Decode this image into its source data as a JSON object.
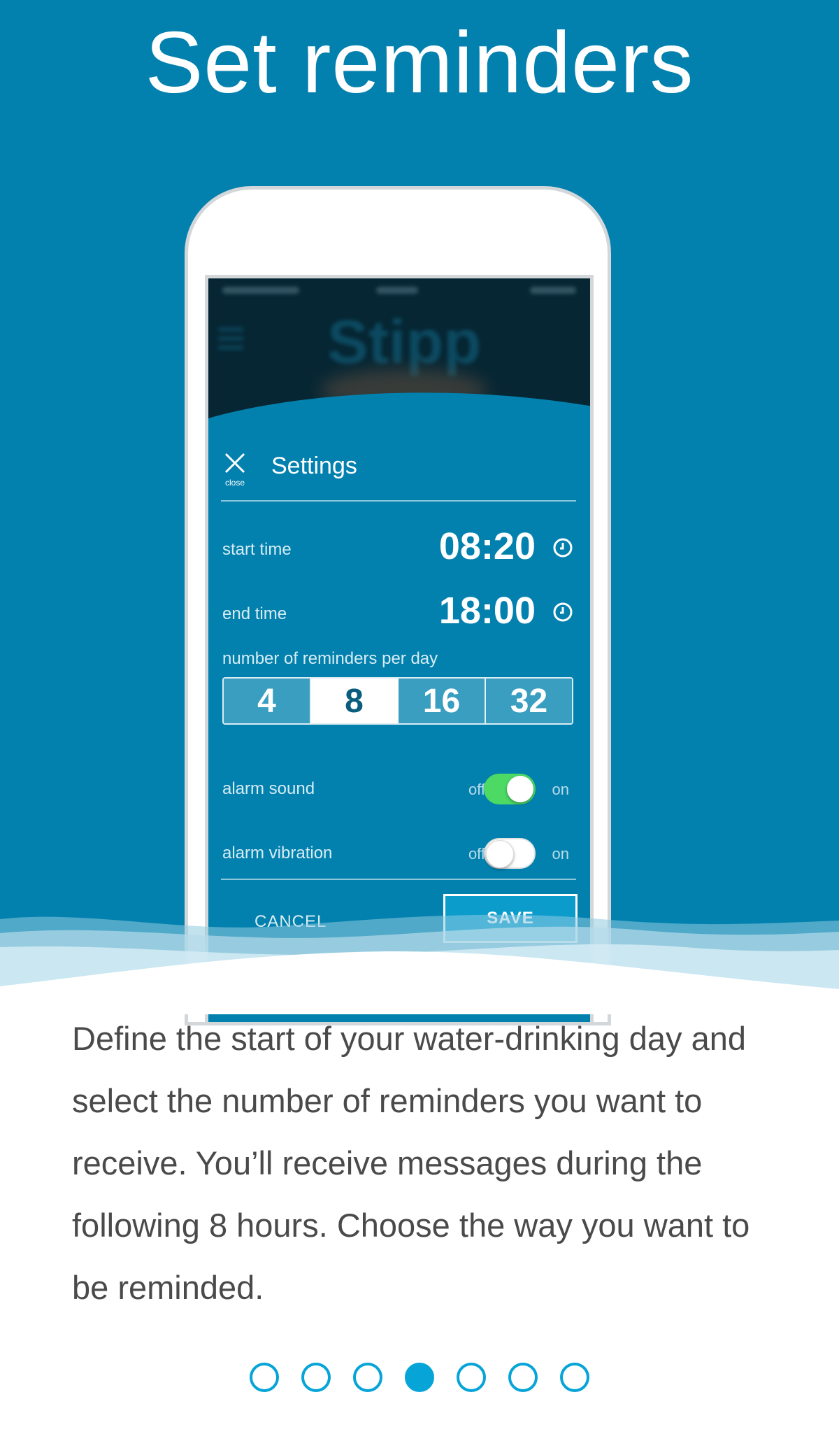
{
  "headline": "Set reminders",
  "phone": {
    "background_app": {
      "logo_text": "Stipp"
    },
    "settings": {
      "close_label": "close",
      "title": "Settings",
      "start_time": {
        "label": "start time",
        "value": "08:20"
      },
      "end_time": {
        "label": "end time",
        "value": "18:00"
      },
      "reminders": {
        "label": "number of reminders per day",
        "options": [
          "4",
          "8",
          "16",
          "32"
        ],
        "selected": "8"
      },
      "alarm_sound": {
        "label": "alarm sound",
        "off_label": "off",
        "on_label": "on",
        "state": "on"
      },
      "alarm_vibration": {
        "label": "alarm vibration",
        "off_label": "off",
        "on_label": "on",
        "state": "off"
      },
      "cancel_label": "CANCEL",
      "save_label": "SAVE"
    }
  },
  "description": "Define the start of your water-drinking day and select the number of reminders you want to receive. You’ll receive messages during the following 8 hours. Choose the way you want to be reminded.",
  "pagination": {
    "total": 7,
    "current": 4
  },
  "colors": {
    "brand_blue": "#0381ae",
    "toggle_on": "#4cd964",
    "dot_accent": "#07a4d8",
    "save_button": "#0b9ccc"
  }
}
